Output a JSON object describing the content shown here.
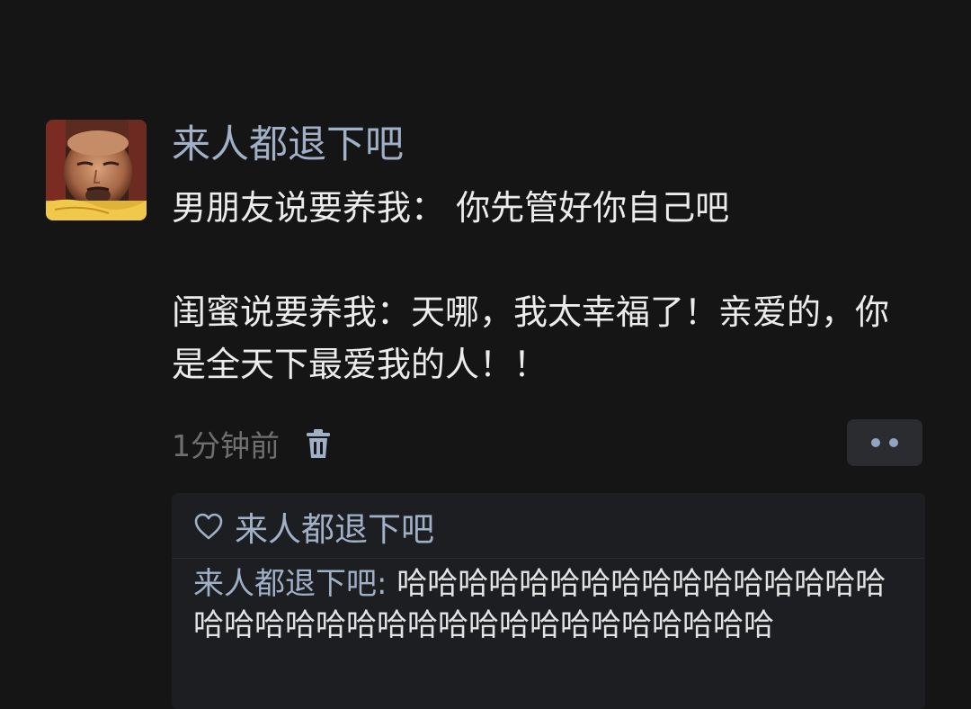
{
  "post": {
    "username": "来人都退下吧",
    "content_line1": "男朋友说要养我： 你先管好你自己吧",
    "content_line2": "闺蜜说要养我：天哪，我太幸福了！亲爱的，你是全天下最爱我的人！！",
    "time": "1分钟前"
  },
  "likes": {
    "names": "来人都退下吧"
  },
  "comments": [
    {
      "author": "来人都退下吧",
      "separator": ": ",
      "text": "哈哈哈哈哈哈哈哈哈哈哈哈哈哈哈哈哈哈哈哈哈哈哈哈哈哈哈哈哈哈哈哈哈哈哈"
    }
  ],
  "colors": {
    "background": "#151515",
    "username": "#9fb0c7",
    "content": "#ececec",
    "time": "#6f6f6f",
    "interaction_panel": "#1d1e21"
  },
  "icons": {
    "avatar": "avatar-photo",
    "delete": "trash-icon",
    "more": "more-dots-icon",
    "like": "heart-outline-icon"
  }
}
